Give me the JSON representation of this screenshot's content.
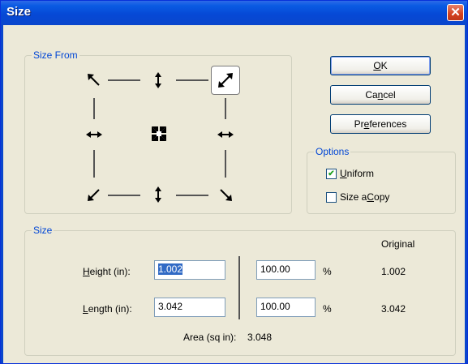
{
  "window": {
    "title": "Size",
    "close_glyph": "✕"
  },
  "size_from": {
    "label": "Size From"
  },
  "buttons": {
    "ok": {
      "hot": "O",
      "rest": "K"
    },
    "cancel": {
      "pre": "Ca",
      "hot": "n",
      "rest": "cel"
    },
    "preferences": {
      "pre": "Pr",
      "hot": "e",
      "rest": "ferences"
    }
  },
  "options": {
    "label": "Options",
    "uniform": {
      "hot": "U",
      "rest": "niform",
      "checked": true,
      "mark": "✔"
    },
    "size_a_copy": {
      "pre": "Size a ",
      "hot": "C",
      "rest": "opy",
      "checked": false
    }
  },
  "size": {
    "label": "Size",
    "original_header": "Original",
    "height": {
      "hot": "H",
      "rest": "eight (in):",
      "value": "1.002",
      "percent": "100.00",
      "percent_unit": "%",
      "original": "1.002"
    },
    "length": {
      "hot": "L",
      "rest": "ength (in):",
      "value": "3.042",
      "percent": "100.00",
      "percent_unit": "%",
      "original": "3.042"
    },
    "area_label": "Area (sq in):",
    "area_value": "3.048"
  }
}
